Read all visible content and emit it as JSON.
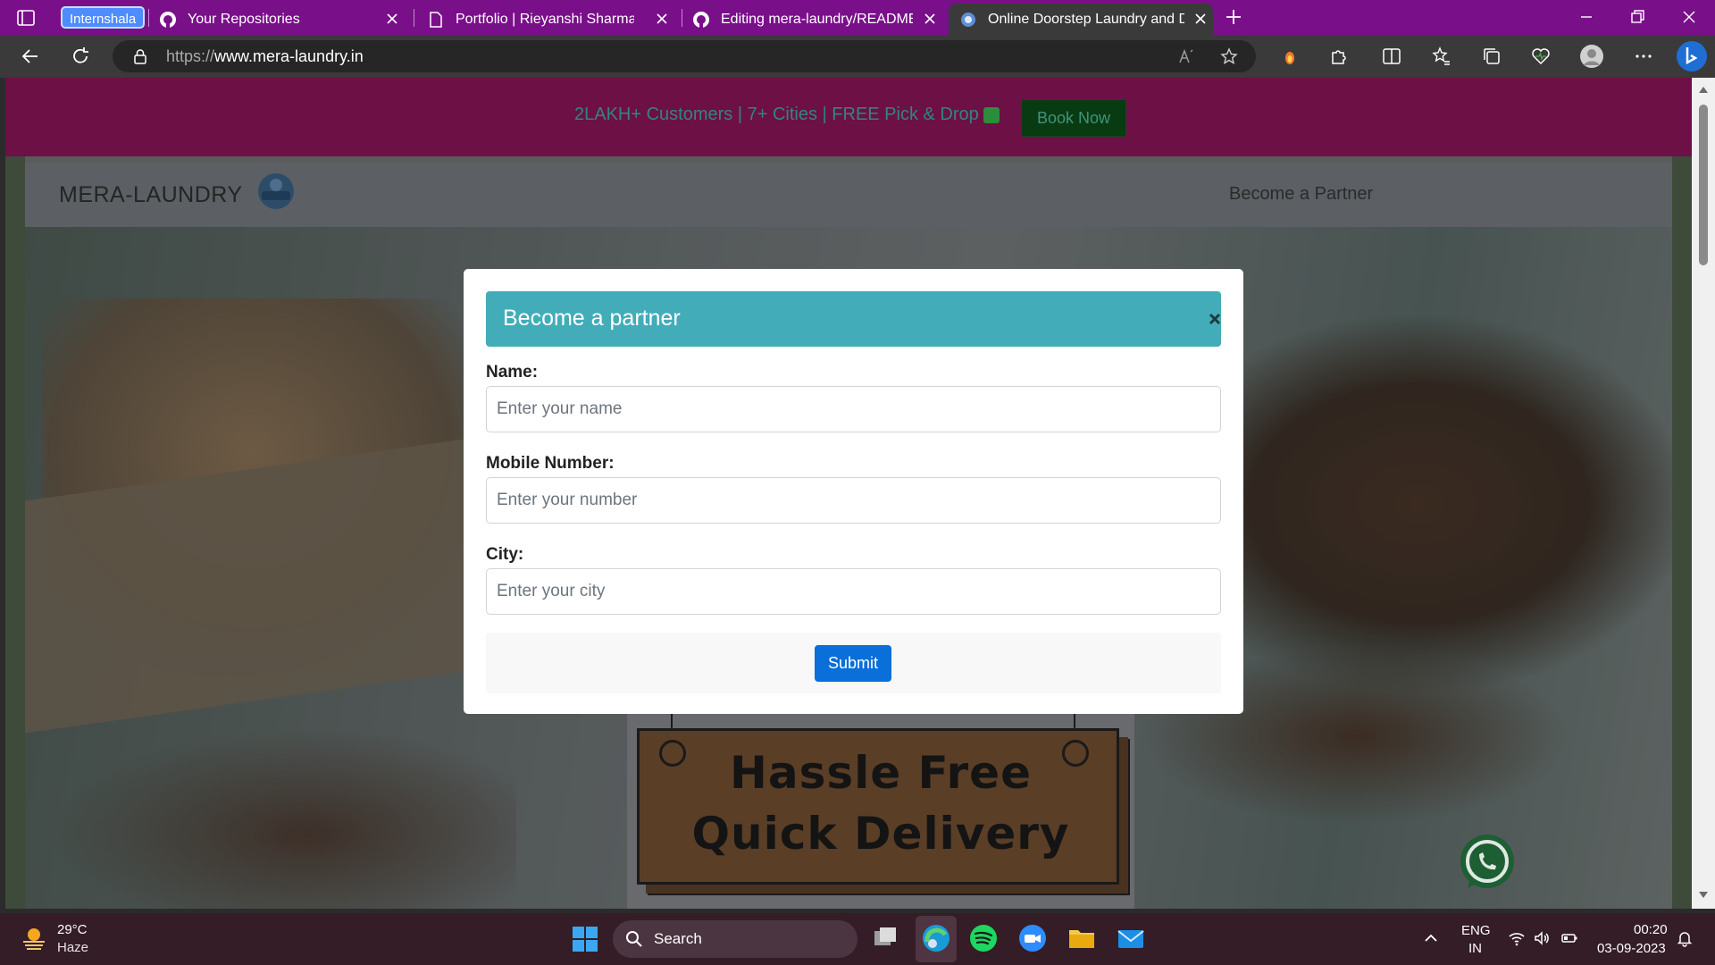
{
  "browser": {
    "tab_group": "Internshala",
    "tabs": [
      {
        "title": "Your Repositories",
        "icon": "github-icon"
      },
      {
        "title": "Portfolio | Rieyanshi Sharma",
        "icon": "page-icon"
      },
      {
        "title": "Editing mera-laundry/README.m",
        "icon": "github-icon"
      },
      {
        "title": "Online Doorstep Laundry and Dr",
        "icon": "laundry-site-icon",
        "active": true
      }
    ],
    "url_scheme": "https://",
    "url_host": "www.mera-laundry.in"
  },
  "promo": {
    "text": "2LAKH+ Customers | 7+ Cities | FREE Pick & Drop",
    "book_now": "Book Now"
  },
  "navbar": {
    "brand": "MERA-LAUNDRY",
    "link_partner": "Become a Partner"
  },
  "hero": {
    "sign_line1": "Hassle Free",
    "sign_line2": "Quick Delivery"
  },
  "modal": {
    "title": "Become a partner",
    "name_label": "Name:",
    "name_placeholder": "Enter your name",
    "mobile_label": "Mobile Number:",
    "mobile_placeholder": "Enter your number",
    "city_label": "City:",
    "city_placeholder": "Enter your city",
    "submit": "Submit"
  },
  "taskbar": {
    "temperature": "29°C",
    "condition": "Haze",
    "search_label": "Search",
    "lang_1": "ENG",
    "lang_2": "IN",
    "time": "00:20",
    "date": "03-09-2023"
  },
  "colors": {
    "tabbar": "#7a0f8a",
    "promo_bar": "#6c1046",
    "modal_header": "#42adb8",
    "submit_button": "#0a6fd8"
  }
}
